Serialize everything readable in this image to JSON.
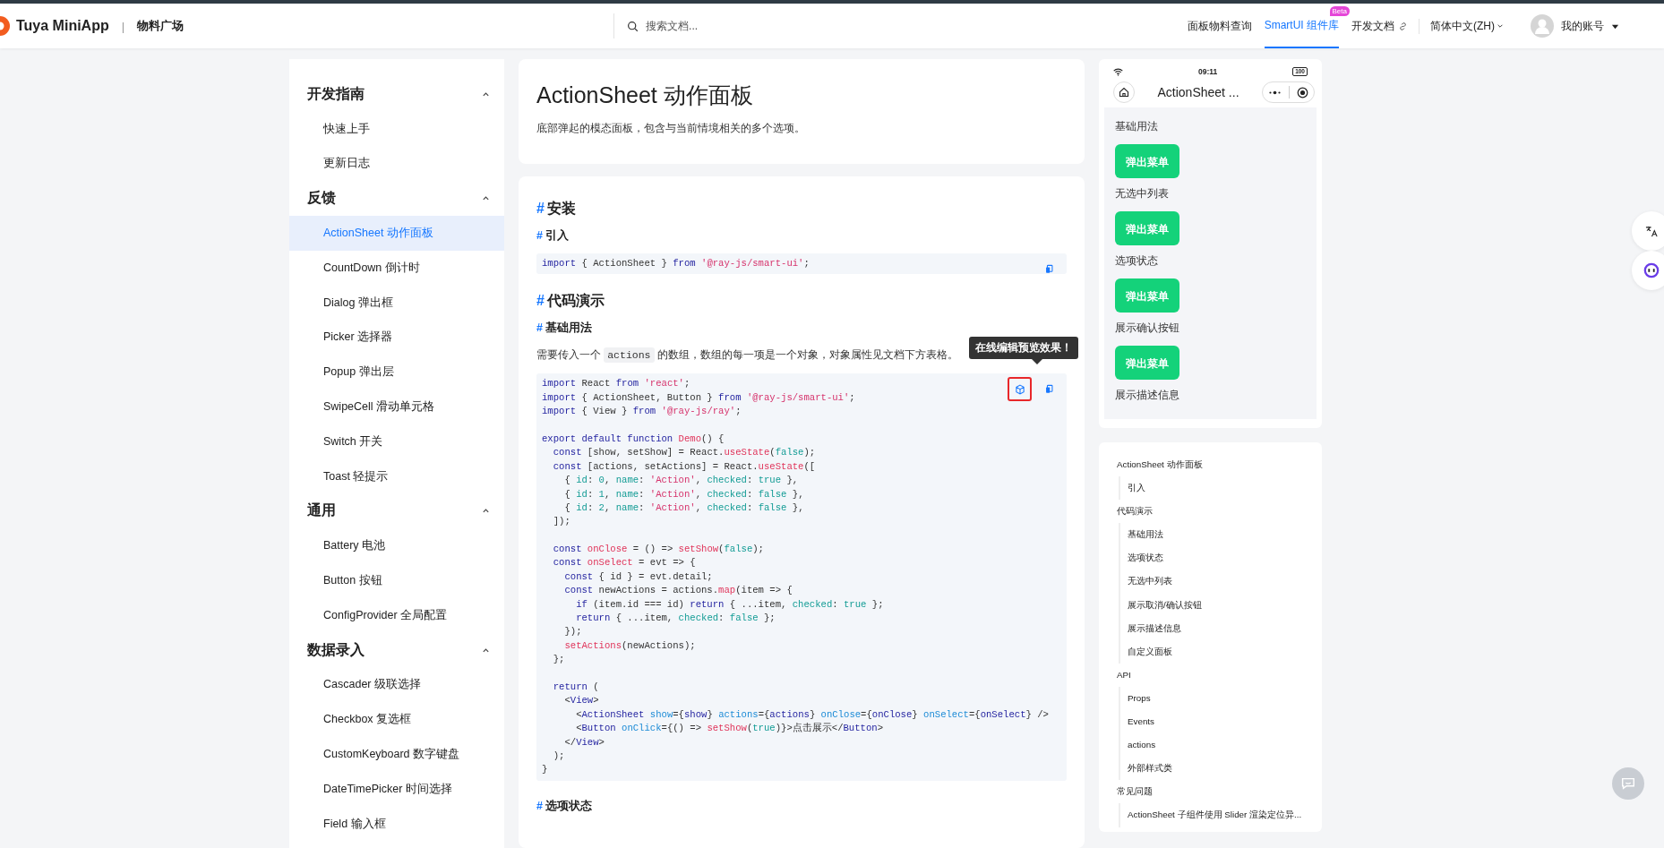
{
  "header": {
    "brand": "Tuya MiniApp",
    "separator": "|",
    "section": "物料广场",
    "search": {
      "placeholder": "搜索文档..."
    },
    "nav": [
      {
        "label": "面板物料查询",
        "kind": "plain",
        "selected": false
      },
      {
        "label": "SmartUI 组件库",
        "kind": "plain",
        "selected": true,
        "badge": "Beta"
      },
      {
        "label": "开发文档",
        "kind": "external",
        "selected": false
      }
    ],
    "language": "简体中文(ZH)",
    "account": "我的账号"
  },
  "sidebar": {
    "groups": [
      {
        "title": "开发指南",
        "expanded": true,
        "items": [
          {
            "label": "快速上手",
            "selected": false
          },
          {
            "label": "更新日志",
            "selected": false
          }
        ]
      },
      {
        "title": "反馈",
        "expanded": true,
        "items": [
          {
            "label": "ActionSheet 动作面板",
            "selected": true
          },
          {
            "label": "CountDown 倒计时",
            "selected": false
          },
          {
            "label": "Dialog 弹出框",
            "selected": false
          },
          {
            "label": "Picker 选择器",
            "selected": false
          },
          {
            "label": "Popup 弹出层",
            "selected": false
          },
          {
            "label": "SwipeCell 滑动单元格",
            "selected": false
          },
          {
            "label": "Switch 开关",
            "selected": false
          },
          {
            "label": "Toast 轻提示",
            "selected": false
          }
        ]
      },
      {
        "title": "通用",
        "expanded": true,
        "items": [
          {
            "label": "Battery 电池",
            "selected": false
          },
          {
            "label": "Button 按钮",
            "selected": false
          },
          {
            "label": "ConfigProvider 全局配置",
            "selected": false
          }
        ]
      },
      {
        "title": "数据录入",
        "expanded": true,
        "items": [
          {
            "label": "Cascader 级联选择",
            "selected": false
          },
          {
            "label": "Checkbox 复选框",
            "selected": false
          },
          {
            "label": "CustomKeyboard 数字键盘",
            "selected": false
          },
          {
            "label": "DateTimePicker 时间选择",
            "selected": false
          },
          {
            "label": "Field 输入框",
            "selected": false
          }
        ]
      }
    ]
  },
  "doc": {
    "title": "ActionSheet 动作面板",
    "description": "底部弹起的模态面板，包含与当前情境相关的多个选项。",
    "blocks": [
      {
        "kind": "h2",
        "hash": "#",
        "text": "安装"
      },
      {
        "kind": "h3",
        "hash": "#",
        "text": "引入"
      },
      {
        "kind": "code",
        "actions": [
          {
            "kind": "copy",
            "highlighted": false
          }
        ],
        "lines": [
          {
            "kind": "code",
            "tokens": [
              {
                "kind": "kw",
                "text": "import"
              },
              {
                "kind": "plain",
                "text": " { ActionSheet } "
              },
              {
                "kind": "kw",
                "text": "from"
              },
              {
                "kind": "str",
                "text": " '@ray-js/smart-ui'"
              },
              {
                "kind": "plain",
                "text": ";"
              }
            ]
          }
        ]
      },
      {
        "kind": "h2",
        "hash": "#",
        "text": "代码演示"
      },
      {
        "kind": "h3",
        "hash": "#",
        "text": "基础用法"
      },
      {
        "kind": "para",
        "parts": [
          {
            "kind": "text",
            "text": "需要传入一个 "
          },
          {
            "kind": "code",
            "text": "actions"
          },
          {
            "kind": "text",
            "text": " 的数组，数组的每一项是一个对象，对象属性见文档下方表格。"
          }
        ]
      },
      {
        "kind": "code",
        "actions": [
          {
            "kind": "playground",
            "highlighted": true,
            "tooltip": "在线编辑预览效果！"
          },
          {
            "kind": "copy",
            "highlighted": false
          }
        ],
        "lines": [
          {
            "kind": "code",
            "tokens": [
              {
                "kind": "kw",
                "text": "import"
              },
              {
                "kind": "plain",
                "text": " React "
              },
              {
                "kind": "kw",
                "text": "from"
              },
              {
                "kind": "str",
                "text": " 'react'"
              },
              {
                "kind": "plain",
                "text": ";"
              }
            ]
          },
          {
            "kind": "code",
            "tokens": [
              {
                "kind": "kw",
                "text": "import"
              },
              {
                "kind": "plain",
                "text": " { ActionSheet, Button } "
              },
              {
                "kind": "kw",
                "text": "from"
              },
              {
                "kind": "str",
                "text": " '@ray-js/smart-ui'"
              },
              {
                "kind": "plain",
                "text": ";"
              }
            ]
          },
          {
            "kind": "code",
            "tokens": [
              {
                "kind": "kw",
                "text": "import"
              },
              {
                "kind": "plain",
                "text": " { View } "
              },
              {
                "kind": "kw",
                "text": "from"
              },
              {
                "kind": "str",
                "text": " '@ray-js/ray'"
              },
              {
                "kind": "plain",
                "text": ";"
              }
            ]
          },
          {
            "kind": "blank"
          },
          {
            "kind": "code",
            "tokens": [
              {
                "kind": "kw",
                "text": "export default function"
              },
              {
                "kind": "fn",
                "text": " Demo"
              },
              {
                "kind": "plain",
                "text": "() {"
              }
            ]
          },
          {
            "kind": "code",
            "tokens": [
              {
                "kind": "kw",
                "text": "  const"
              },
              {
                "kind": "plain",
                "text": " [show, setShow] = React."
              },
              {
                "kind": "fn",
                "text": "useState"
              },
              {
                "kind": "plain",
                "text": "("
              },
              {
                "kind": "lit",
                "text": "false"
              },
              {
                "kind": "plain",
                "text": ");"
              }
            ]
          },
          {
            "kind": "code",
            "tokens": [
              {
                "kind": "kw",
                "text": "  const"
              },
              {
                "kind": "plain",
                "text": " [actions, setActions] = React."
              },
              {
                "kind": "fn",
                "text": "useState"
              },
              {
                "kind": "plain",
                "text": "(["
              }
            ]
          },
          {
            "kind": "code",
            "tokens": [
              {
                "kind": "plain",
                "text": "    { "
              },
              {
                "kind": "lit",
                "text": "id"
              },
              {
                "kind": "plain",
                "text": ": "
              },
              {
                "kind": "lit",
                "text": "0"
              },
              {
                "kind": "plain",
                "text": ", "
              },
              {
                "kind": "lit",
                "text": "name"
              },
              {
                "kind": "plain",
                "text": ": "
              },
              {
                "kind": "str",
                "text": "'Action'"
              },
              {
                "kind": "plain",
                "text": ", "
              },
              {
                "kind": "lit",
                "text": "checked"
              },
              {
                "kind": "plain",
                "text": ": "
              },
              {
                "kind": "lit",
                "text": "true"
              },
              {
                "kind": "plain",
                "text": " },"
              }
            ]
          },
          {
            "kind": "code",
            "tokens": [
              {
                "kind": "plain",
                "text": "    { "
              },
              {
                "kind": "lit",
                "text": "id"
              },
              {
                "kind": "plain",
                "text": ": "
              },
              {
                "kind": "lit",
                "text": "1"
              },
              {
                "kind": "plain",
                "text": ", "
              },
              {
                "kind": "lit",
                "text": "name"
              },
              {
                "kind": "plain",
                "text": ": "
              },
              {
                "kind": "str",
                "text": "'Action'"
              },
              {
                "kind": "plain",
                "text": ", "
              },
              {
                "kind": "lit",
                "text": "checked"
              },
              {
                "kind": "plain",
                "text": ": "
              },
              {
                "kind": "lit",
                "text": "false"
              },
              {
                "kind": "plain",
                "text": " },"
              }
            ]
          },
          {
            "kind": "code",
            "tokens": [
              {
                "kind": "plain",
                "text": "    { "
              },
              {
                "kind": "lit",
                "text": "id"
              },
              {
                "kind": "plain",
                "text": ": "
              },
              {
                "kind": "lit",
                "text": "2"
              },
              {
                "kind": "plain",
                "text": ", "
              },
              {
                "kind": "lit",
                "text": "name"
              },
              {
                "kind": "plain",
                "text": ": "
              },
              {
                "kind": "str",
                "text": "'Action'"
              },
              {
                "kind": "plain",
                "text": ", "
              },
              {
                "kind": "lit",
                "text": "checked"
              },
              {
                "kind": "plain",
                "text": ": "
              },
              {
                "kind": "lit",
                "text": "false"
              },
              {
                "kind": "plain",
                "text": " },"
              }
            ]
          },
          {
            "kind": "code",
            "tokens": [
              {
                "kind": "plain",
                "text": "  ]);"
              }
            ]
          },
          {
            "kind": "blank"
          },
          {
            "kind": "code",
            "tokens": [
              {
                "kind": "kw",
                "text": "  const"
              },
              {
                "kind": "fn",
                "text": " onClose"
              },
              {
                "kind": "plain",
                "text": " = () => "
              },
              {
                "kind": "fn",
                "text": "setShow"
              },
              {
                "kind": "plain",
                "text": "("
              },
              {
                "kind": "lit",
                "text": "false"
              },
              {
                "kind": "plain",
                "text": ");"
              }
            ]
          },
          {
            "kind": "code",
            "tokens": [
              {
                "kind": "kw",
                "text": "  const"
              },
              {
                "kind": "fn",
                "text": " onSelect"
              },
              {
                "kind": "plain",
                "text": " = evt => {"
              }
            ]
          },
          {
            "kind": "code",
            "tokens": [
              {
                "kind": "kw",
                "text": "    const"
              },
              {
                "kind": "plain",
                "text": " { id } = evt.detail;"
              }
            ]
          },
          {
            "kind": "code",
            "tokens": [
              {
                "kind": "kw",
                "text": "    const"
              },
              {
                "kind": "plain",
                "text": " newActions = actions."
              },
              {
                "kind": "fn",
                "text": "map"
              },
              {
                "kind": "plain",
                "text": "(item => {"
              }
            ]
          },
          {
            "kind": "code",
            "tokens": [
              {
                "kind": "kw",
                "text": "      if"
              },
              {
                "kind": "plain",
                "text": " (item.id === id) "
              },
              {
                "kind": "kw",
                "text": "return"
              },
              {
                "kind": "plain",
                "text": " { ...item, "
              },
              {
                "kind": "lit",
                "text": "checked"
              },
              {
                "kind": "plain",
                "text": ": "
              },
              {
                "kind": "lit",
                "text": "true"
              },
              {
                "kind": "plain",
                "text": " };"
              }
            ]
          },
          {
            "kind": "code",
            "tokens": [
              {
                "kind": "kw",
                "text": "      return"
              },
              {
                "kind": "plain",
                "text": " { ...item, "
              },
              {
                "kind": "lit",
                "text": "checked"
              },
              {
                "kind": "plain",
                "text": ": "
              },
              {
                "kind": "lit",
                "text": "false"
              },
              {
                "kind": "plain",
                "text": " };"
              }
            ]
          },
          {
            "kind": "code",
            "tokens": [
              {
                "kind": "plain",
                "text": "    });"
              }
            ]
          },
          {
            "kind": "code",
            "tokens": [
              {
                "kind": "fn",
                "text": "    setActions"
              },
              {
                "kind": "plain",
                "text": "(newActions);"
              }
            ]
          },
          {
            "kind": "code",
            "tokens": [
              {
                "kind": "plain",
                "text": "  };"
              }
            ]
          },
          {
            "kind": "blank"
          },
          {
            "kind": "code",
            "tokens": [
              {
                "kind": "kw",
                "text": "  return"
              },
              {
                "kind": "plain",
                "text": " ("
              }
            ]
          },
          {
            "kind": "code",
            "tokens": [
              {
                "kind": "plain",
                "text": "    <"
              },
              {
                "kind": "kw",
                "text": "View"
              },
              {
                "kind": "plain",
                "text": ">"
              }
            ]
          },
          {
            "kind": "code",
            "tokens": [
              {
                "kind": "plain",
                "text": "      <"
              },
              {
                "kind": "kw",
                "text": "ActionSheet"
              },
              {
                "kind": "attr",
                "text": " show"
              },
              {
                "kind": "plain",
                "text": "={"
              },
              {
                "kind": "kw",
                "text": "show"
              },
              {
                "kind": "plain",
                "text": "} "
              },
              {
                "kind": "attr",
                "text": "actions"
              },
              {
                "kind": "plain",
                "text": "={"
              },
              {
                "kind": "kw",
                "text": "actions"
              },
              {
                "kind": "plain",
                "text": "} "
              },
              {
                "kind": "attr",
                "text": "onClose"
              },
              {
                "kind": "plain",
                "text": "={"
              },
              {
                "kind": "kw",
                "text": "onClose"
              },
              {
                "kind": "plain",
                "text": "} "
              },
              {
                "kind": "attr",
                "text": "onSelect"
              },
              {
                "kind": "plain",
                "text": "={"
              },
              {
                "kind": "kw",
                "text": "onSelect"
              },
              {
                "kind": "plain",
                "text": "} />"
              }
            ]
          },
          {
            "kind": "code",
            "tokens": [
              {
                "kind": "plain",
                "text": "      <"
              },
              {
                "kind": "kw",
                "text": "Button"
              },
              {
                "kind": "attr",
                "text": " onClick"
              },
              {
                "kind": "plain",
                "text": "={() => "
              },
              {
                "kind": "fn",
                "text": "setShow"
              },
              {
                "kind": "plain",
                "text": "("
              },
              {
                "kind": "lit",
                "text": "true"
              },
              {
                "kind": "plain",
                "text": ")}>点击展示</"
              },
              {
                "kind": "kw",
                "text": "Button"
              },
              {
                "kind": "plain",
                "text": ">"
              }
            ]
          },
          {
            "kind": "code",
            "tokens": [
              {
                "kind": "plain",
                "text": "    </"
              },
              {
                "kind": "kw",
                "text": "View"
              },
              {
                "kind": "plain",
                "text": ">"
              }
            ]
          },
          {
            "kind": "code",
            "tokens": [
              {
                "kind": "plain",
                "text": "  );"
              }
            ]
          },
          {
            "kind": "code",
            "tokens": [
              {
                "kind": "plain",
                "text": "}"
              }
            ]
          }
        ]
      },
      {
        "kind": "h3",
        "hash": "#",
        "text": "选项状态"
      }
    ]
  },
  "preview": {
    "time": "09:11",
    "battery": "100",
    "title": "ActionSheet ...",
    "demos": [
      {
        "label": "基础用法",
        "button": "弹出菜单"
      },
      {
        "label": "无选中列表",
        "button": "弹出菜单"
      },
      {
        "label": "选项状态",
        "button": "弹出菜单"
      },
      {
        "label": "展示确认按钮",
        "button": "弹出菜单"
      },
      {
        "label": "展示描述信息"
      }
    ]
  },
  "toc": [
    {
      "label": "ActionSheet 动作面板",
      "children": [
        {
          "label": "引入"
        }
      ]
    },
    {
      "label": "代码演示",
      "children": [
        {
          "label": "基础用法"
        },
        {
          "label": "选项状态"
        },
        {
          "label": "无选中列表"
        },
        {
          "label": "展示取消/确认按钮"
        },
        {
          "label": "展示描述信息"
        },
        {
          "label": "自定义面板"
        }
      ]
    },
    {
      "label": "API",
      "children": [
        {
          "label": "Props"
        },
        {
          "label": "Events"
        },
        {
          "label": "actions"
        },
        {
          "label": "外部样式类"
        }
      ]
    },
    {
      "label": "常见问题",
      "children": [
        {
          "label": "ActionSheet 子组件使用 Slider 渲染定位异..."
        }
      ]
    }
  ]
}
